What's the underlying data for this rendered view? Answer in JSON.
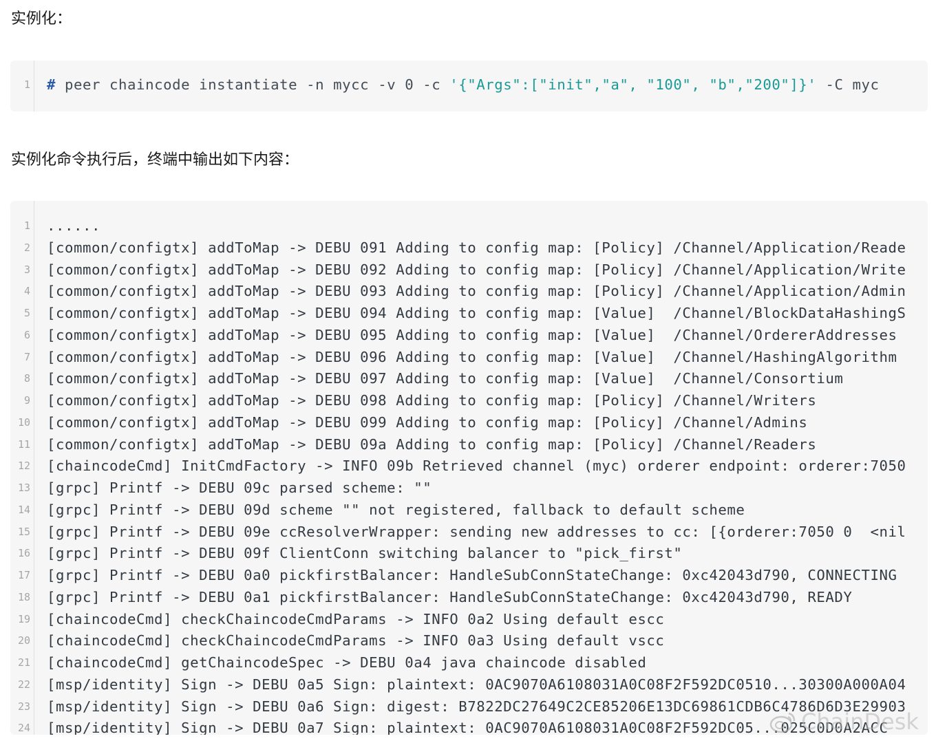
{
  "headings": {
    "instantiate": "实例化：",
    "output_intro": "实例化命令执行后，终端中输出如下内容："
  },
  "command_block": {
    "line_number": "1",
    "prompt": "#",
    "command": " peer chaincode instantiate -n mycc -v 0 -c ",
    "args": "'{\"Args\":[\"init\",\"a\", \"100\", \"b\",\"200\"]}'",
    "tail": " -C myc"
  },
  "output_block": {
    "lines": [
      {
        "num": "1",
        "text": "......"
      },
      {
        "num": "2",
        "text": "[common/configtx] addToMap -> DEBU 091 Adding to config map: [Policy] /Channel/Application/Reade"
      },
      {
        "num": "3",
        "text": "[common/configtx] addToMap -> DEBU 092 Adding to config map: [Policy] /Channel/Application/Write"
      },
      {
        "num": "4",
        "text": "[common/configtx] addToMap -> DEBU 093 Adding to config map: [Policy] /Channel/Application/Admin"
      },
      {
        "num": "5",
        "text": "[common/configtx] addToMap -> DEBU 094 Adding to config map: [Value]  /Channel/BlockDataHashingS"
      },
      {
        "num": "6",
        "text": "[common/configtx] addToMap -> DEBU 095 Adding to config map: [Value]  /Channel/OrdererAddresses"
      },
      {
        "num": "7",
        "text": "[common/configtx] addToMap -> DEBU 096 Adding to config map: [Value]  /Channel/HashingAlgorithm"
      },
      {
        "num": "8",
        "text": "[common/configtx] addToMap -> DEBU 097 Adding to config map: [Value]  /Channel/Consortium"
      },
      {
        "num": "9",
        "text": "[common/configtx] addToMap -> DEBU 098 Adding to config map: [Policy] /Channel/Writers"
      },
      {
        "num": "10",
        "text": "[common/configtx] addToMap -> DEBU 099 Adding to config map: [Policy] /Channel/Admins"
      },
      {
        "num": "11",
        "text": "[common/configtx] addToMap -> DEBU 09a Adding to config map: [Policy] /Channel/Readers"
      },
      {
        "num": "12",
        "text": "[chaincodeCmd] InitCmdFactory -> INFO 09b Retrieved channel (myc) orderer endpoint: orderer:7050"
      },
      {
        "num": "13",
        "text": "[grpc] Printf -> DEBU 09c parsed scheme: \"\""
      },
      {
        "num": "14",
        "text": "[grpc] Printf -> DEBU 09d scheme \"\" not registered, fallback to default scheme"
      },
      {
        "num": "15",
        "text": "[grpc] Printf -> DEBU 09e ccResolverWrapper: sending new addresses to cc: [{orderer:7050 0  <nil"
      },
      {
        "num": "16",
        "text": "[grpc] Printf -> DEBU 09f ClientConn switching balancer to \"pick_first\""
      },
      {
        "num": "17",
        "text": "[grpc] Printf -> DEBU 0a0 pickfirstBalancer: HandleSubConnStateChange: 0xc42043d790, CONNECTING"
      },
      {
        "num": "18",
        "text": "[grpc] Printf -> DEBU 0a1 pickfirstBalancer: HandleSubConnStateChange: 0xc42043d790, READY"
      },
      {
        "num": "19",
        "text": "[chaincodeCmd] checkChaincodeCmdParams -> INFO 0a2 Using default escc"
      },
      {
        "num": "20",
        "text": "[chaincodeCmd] checkChaincodeCmdParams -> INFO 0a3 Using default vscc"
      },
      {
        "num": "21",
        "text": "[chaincodeCmd] getChaincodeSpec -> DEBU 0a4 java chaincode disabled"
      },
      {
        "num": "22",
        "text": "[msp/identity] Sign -> DEBU 0a5 Sign: plaintext: 0AC9070A6108031A0C08F2F592DC0510...30300A000A04"
      },
      {
        "num": "23",
        "text": "[msp/identity] Sign -> DEBU 0a6 Sign: digest: B7822DC27649C2CE85206E13DC69861CDB6C4786D6D3E29903"
      },
      {
        "num": "24",
        "text": "[msp/identity] Sign -> DEBU 0a7 Sign: plaintext: 0AC9070A6108031A0C08F2F592DC05...025C0D0A2ACC"
      }
    ]
  },
  "watermark": {
    "text": "ChainDesk",
    "icon": "weibo-icon"
  }
}
